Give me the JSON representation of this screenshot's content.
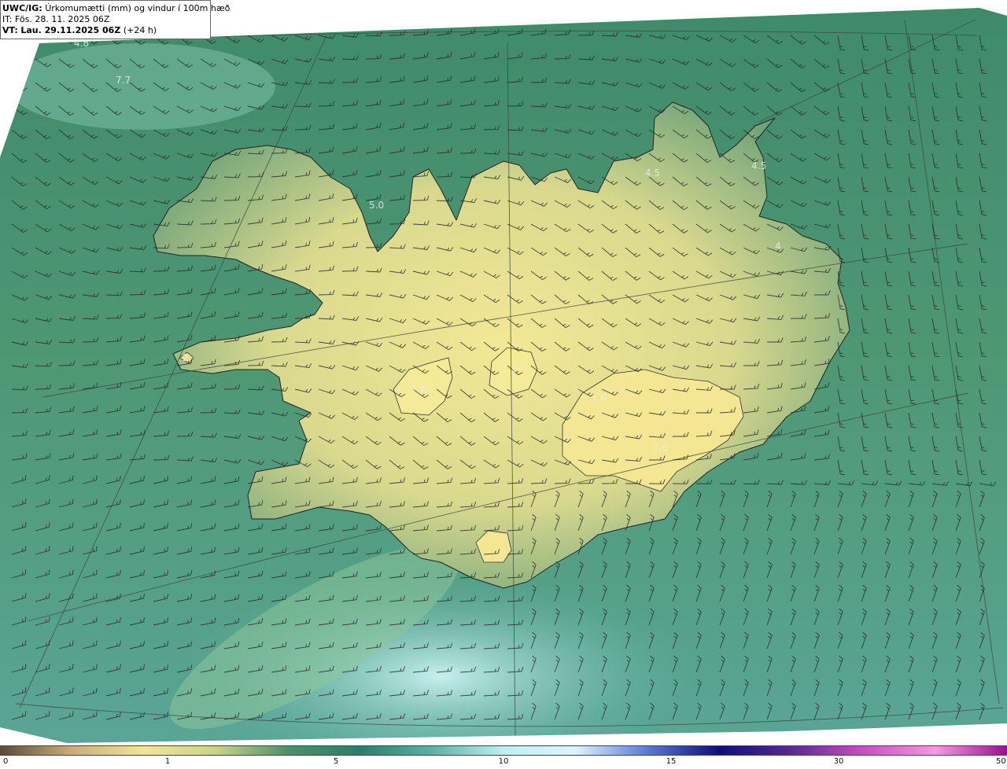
{
  "header": {
    "model_code": "UWC/IG:",
    "title": "Úrkomumætti (mm) og vindur í 100m hæð",
    "init_label": "IT:",
    "init_time": "Fös. 28. 11. 2025 06Z",
    "valid_label": "VT:",
    "valid_time": "Lau. 29.11.2025 06Z",
    "lead_time": "(+24 h)"
  },
  "contour_labels": [
    "4.8",
    "7.7",
    "5.0",
    "4.5",
    "4.5",
    "4",
    "2",
    "1.2",
    "1.4",
    "1.0",
    "1.0"
  ],
  "colorbar": {
    "ticks": [
      "0",
      "1",
      "5",
      "10",
      "15",
      "30",
      "50"
    ],
    "colors": [
      "#5a4a38",
      "#c9ad7a",
      "#f2e39a",
      "#c7d48a",
      "#4f8f6a",
      "#2e7d6a",
      "#5fb0a0",
      "#bff0ee",
      "#dcf4ff",
      "#5a7ad0",
      "#0e0e7a",
      "#5a2a90",
      "#c74fc0",
      "#f39ae0",
      "#9a108a"
    ]
  }
}
